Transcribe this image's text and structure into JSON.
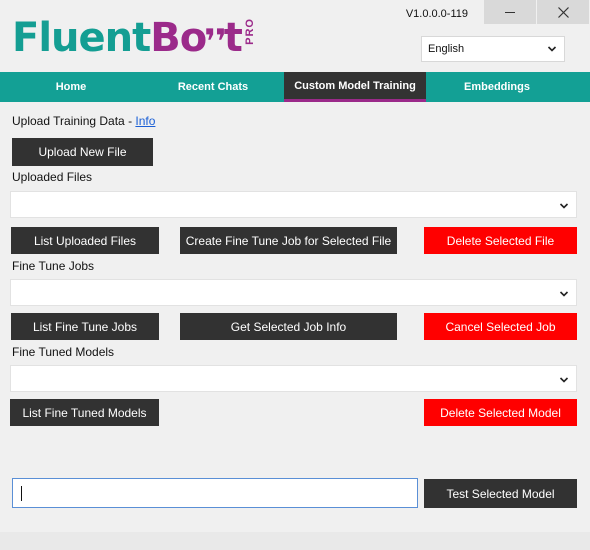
{
  "header": {
    "logo": {
      "part1": "Fluent",
      "part2": "Bo",
      "part3": "t",
      "badge": "PRO"
    },
    "version": "V1.0.0.0-119",
    "language": {
      "selected": "English"
    }
  },
  "nav": {
    "tabs": [
      {
        "label": "Home"
      },
      {
        "label": "Recent Chats"
      },
      {
        "label": "Custom Model Training"
      },
      {
        "label": "Embeddings"
      }
    ]
  },
  "upload": {
    "label": "Upload Training Data - ",
    "info_link": "Info",
    "upload_button": "Upload New File"
  },
  "files": {
    "label": "Uploaded Files",
    "selected": "",
    "list_button": "List Uploaded Files",
    "create_job_button": "Create Fine Tune Job for Selected File",
    "delete_button": "Delete Selected File"
  },
  "jobs": {
    "label": "Fine Tune Jobs",
    "selected": "",
    "list_button": "List Fine Tune Jobs",
    "info_button": "Get Selected Job Info",
    "cancel_button": "Cancel Selected Job"
  },
  "models": {
    "label": "Fine Tuned Models",
    "selected": "",
    "list_button": "List Fine Tuned Models",
    "delete_button": "Delete Selected Model"
  },
  "test": {
    "input_value": "",
    "test_button": "Test Selected Model"
  },
  "colors": {
    "teal": "#13a095",
    "purple": "#9b2a8a",
    "dark": "#323232",
    "red": "#ff0000"
  }
}
